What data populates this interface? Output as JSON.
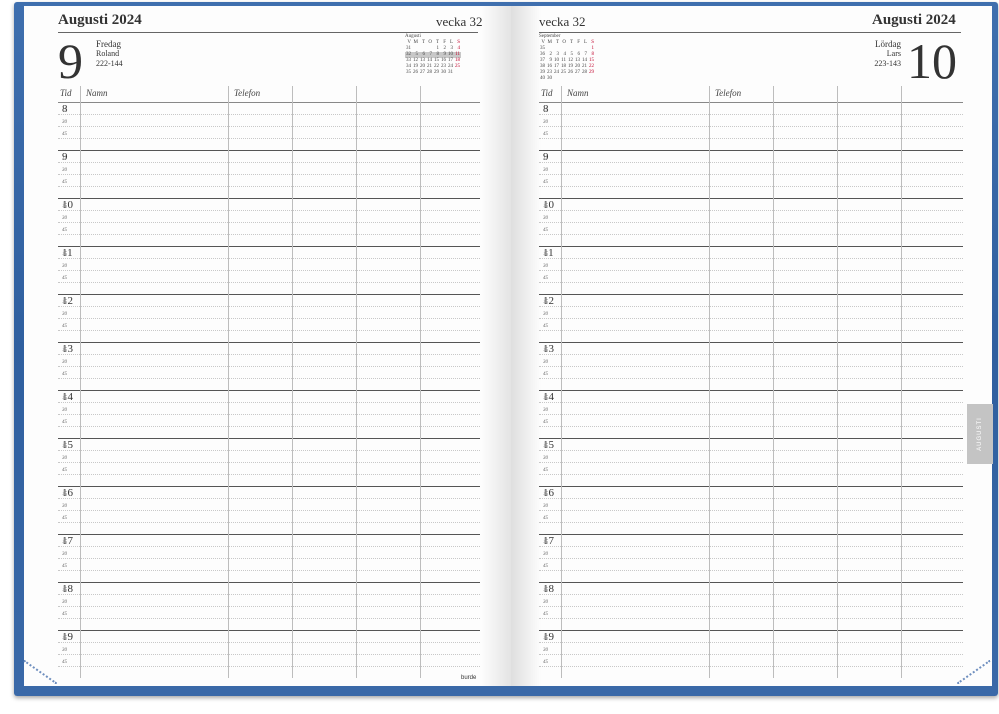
{
  "left_page": {
    "month_year": "Augusti 2024",
    "week": "vecka 32",
    "day_number": "9",
    "weekday": "Fredag",
    "name_day": "Roland",
    "day_count": "222-144",
    "col_time": "Tid",
    "col_name": "Namn",
    "col_phone": "Telefon",
    "brand": "burde",
    "mini_calendar": {
      "title": "Augusti",
      "headers": [
        "V",
        "M",
        "T",
        "O",
        "T",
        "F",
        "L",
        "S"
      ],
      "rows": [
        [
          "31",
          "",
          "",
          "",
          "1",
          "2",
          "3",
          "4"
        ],
        [
          "32",
          "5",
          "6",
          "7",
          "8",
          "9",
          "10",
          "11"
        ],
        [
          "33",
          "12",
          "13",
          "14",
          "15",
          "16",
          "17",
          "18"
        ],
        [
          "34",
          "19",
          "20",
          "21",
          "22",
          "23",
          "24",
          "25"
        ],
        [
          "35",
          "26",
          "27",
          "28",
          "29",
          "30",
          "31",
          ""
        ]
      ],
      "highlight_row": 1
    }
  },
  "right_page": {
    "month_year": "Augusti 2024",
    "week": "vecka 32",
    "day_number": "10",
    "weekday": "Lördag",
    "name_day": "Lars",
    "day_count": "223-143",
    "col_time": "Tid",
    "col_name": "Namn",
    "col_phone": "Telefon",
    "mini_calendar": {
      "title": "September",
      "headers": [
        "V",
        "M",
        "T",
        "O",
        "T",
        "F",
        "L",
        "S"
      ],
      "rows": [
        [
          "35",
          "",
          "",
          "",
          "",
          "",
          "",
          "1"
        ],
        [
          "36",
          "2",
          "3",
          "4",
          "5",
          "6",
          "7",
          "8"
        ],
        [
          "37",
          "9",
          "10",
          "11",
          "12",
          "13",
          "14",
          "15"
        ],
        [
          "38",
          "16",
          "17",
          "18",
          "19",
          "20",
          "21",
          "22"
        ],
        [
          "39",
          "23",
          "24",
          "25",
          "26",
          "27",
          "28",
          "29"
        ],
        [
          "40",
          "30",
          "",
          "",
          "",
          "",
          "",
          ""
        ]
      ]
    },
    "month_tab": "AUGUSTI"
  },
  "hours": [
    "8",
    "9",
    "10",
    "11",
    "12",
    "13",
    "14",
    "15",
    "16",
    "17",
    "18",
    "19"
  ],
  "quarters": [
    "15",
    "30",
    "45"
  ],
  "colors": {
    "cover": "#3a69a8",
    "page": "#fdfdfd",
    "sunday_red": "#c0002a",
    "tab": "#c4c4c4"
  }
}
